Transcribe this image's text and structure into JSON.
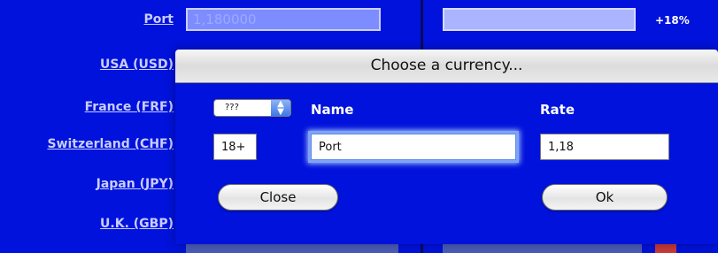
{
  "window": {
    "port_label": "Port",
    "port_value": "1,180000",
    "percent_badge": "+18%",
    "currencies": [
      "USA (USD)",
      "France (FRF)",
      "Switzerland (CHF)",
      "Japan (JPY)",
      "U.K. (GBP)"
    ]
  },
  "dialog": {
    "title": "Choose a currency...",
    "popup_selected": "???",
    "name_header": "Name",
    "rate_header": "Rate",
    "code_value": "18+",
    "name_value": "Port",
    "rate_value": "1,18",
    "close_label": "Close",
    "ok_label": "Ok"
  },
  "colors": {
    "background": "#0012dc",
    "field_fill": "#7d8cff",
    "focus_ring": "#7fa4f5"
  }
}
